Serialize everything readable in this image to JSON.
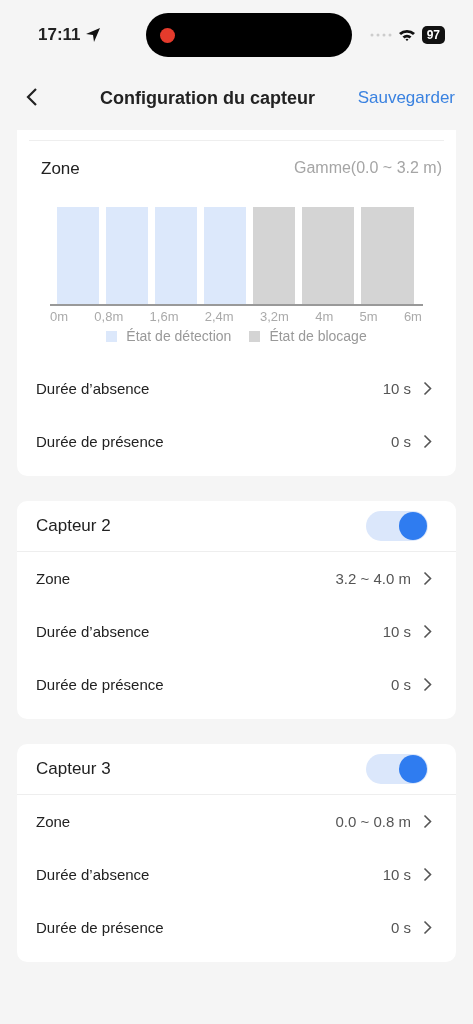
{
  "status_bar": {
    "time": "17:11",
    "battery": "97"
  },
  "nav": {
    "title": "Configuration du capteur",
    "action": "Sauvegarder"
  },
  "zone_card": {
    "title": "Zone",
    "range": "Gamme(0.0 ~ 3.2 m)",
    "segments": [
      {
        "color": "#dce8fb"
      },
      {
        "color": "#dce8fb"
      },
      {
        "color": "#dce8fb"
      },
      {
        "color": "#dce8fb"
      },
      {
        "color": "#d4d4d4"
      },
      {
        "color": "#d4d4d4"
      },
      {
        "color": "#d4d4d4"
      }
    ],
    "ticks": [
      "0m",
      "0,8m",
      "1,6m",
      "2,4m",
      "3,2m",
      "4m",
      "5m",
      "6m"
    ],
    "legend": [
      {
        "label": "État de détection",
        "color": "#dce8fb"
      },
      {
        "label": "État de blocage",
        "color": "#d4d4d4"
      }
    ],
    "rows": [
      {
        "label": "Durée d’absence",
        "value": "10 s"
      },
      {
        "label": "Durée de présence",
        "value": "0 s"
      }
    ]
  },
  "sensors": [
    {
      "title": "Capteur 2",
      "on": true,
      "rows": [
        {
          "label": "Zone",
          "value": "3.2 ~ 4.0 m"
        },
        {
          "label": "Durée d’absence",
          "value": "10 s"
        },
        {
          "label": "Durée de présence",
          "value": "0 s"
        }
      ]
    },
    {
      "title": "Capteur 3",
      "on": true,
      "rows": [
        {
          "label": "Zone",
          "value": "0.0 ~ 0.8 m"
        },
        {
          "label": "Durée d’absence",
          "value": "10 s"
        },
        {
          "label": "Durée de présence",
          "value": "0 s"
        }
      ]
    }
  ]
}
